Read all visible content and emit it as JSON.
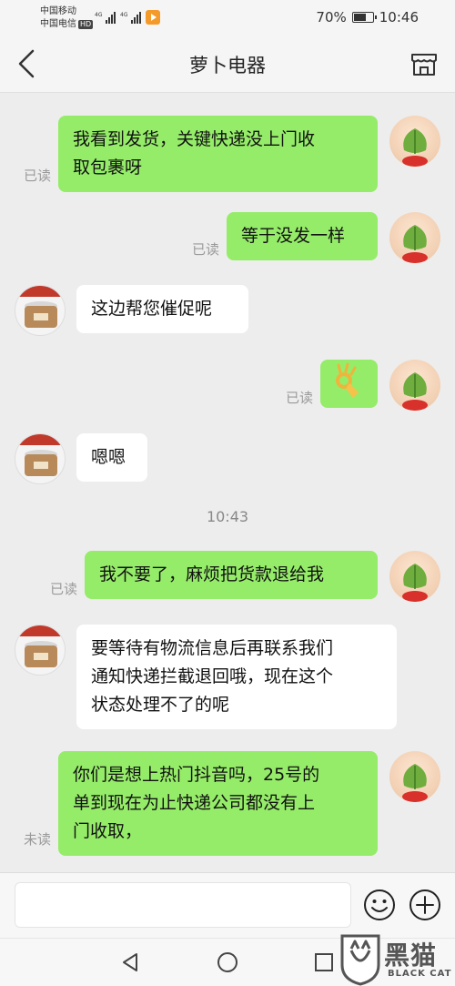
{
  "status_bar": {
    "carrier1": "中国移动",
    "carrier2": "中国电信",
    "hd": "HD",
    "net1": "4G",
    "net2": "4G",
    "battery_text": "70%",
    "battery_level": 0.7,
    "time": "10:46"
  },
  "header": {
    "title": "萝卜电器",
    "back_icon": "chevron-left-icon",
    "store_icon": "store-icon"
  },
  "messages": [
    {
      "sender": "me",
      "lines": [
        "我看到发货，关键快递没上门收",
        "取包裹呀"
      ],
      "status": "已读"
    },
    {
      "sender": "me",
      "lines": [
        "等于没发一样"
      ],
      "status": "已读"
    },
    {
      "sender": "shop",
      "lines": [
        "这边帮您催促呢"
      ]
    },
    {
      "sender": "me",
      "type": "emoji",
      "emoji": "ok-hand-icon",
      "status": "已读"
    },
    {
      "sender": "shop",
      "lines": [
        "嗯嗯"
      ]
    },
    {
      "sender": "me",
      "lines": [
        "我不要了，麻烦把货款退给我"
      ],
      "status": "已读"
    },
    {
      "sender": "shop",
      "lines": [
        "要等待有物流信息后再联系我们",
        "通知快递拦截退回哦，现在这个",
        "状态处理不了的呢"
      ]
    },
    {
      "sender": "me",
      "lines": [
        "你们是想上热门抖音吗，25号的",
        "单到现在为止快递公司都没有上",
        "门收取，"
      ],
      "status": "未读"
    }
  ],
  "timestamp": "10:43",
  "input_bar": {
    "placeholder": "",
    "emoji_icon": "smiley-icon",
    "plus_icon": "plus-icon"
  },
  "nav_bar": {
    "back_icon": "triangle-back-icon",
    "home_icon": "circle-home-icon",
    "recent_icon": "square-recent-icon"
  },
  "watermark": {
    "text": "黑猫",
    "sub": "BLACK CAT"
  },
  "colors": {
    "my_bubble": "#95ec69",
    "shop_bubble": "#ffffff",
    "background": "#ededed"
  }
}
